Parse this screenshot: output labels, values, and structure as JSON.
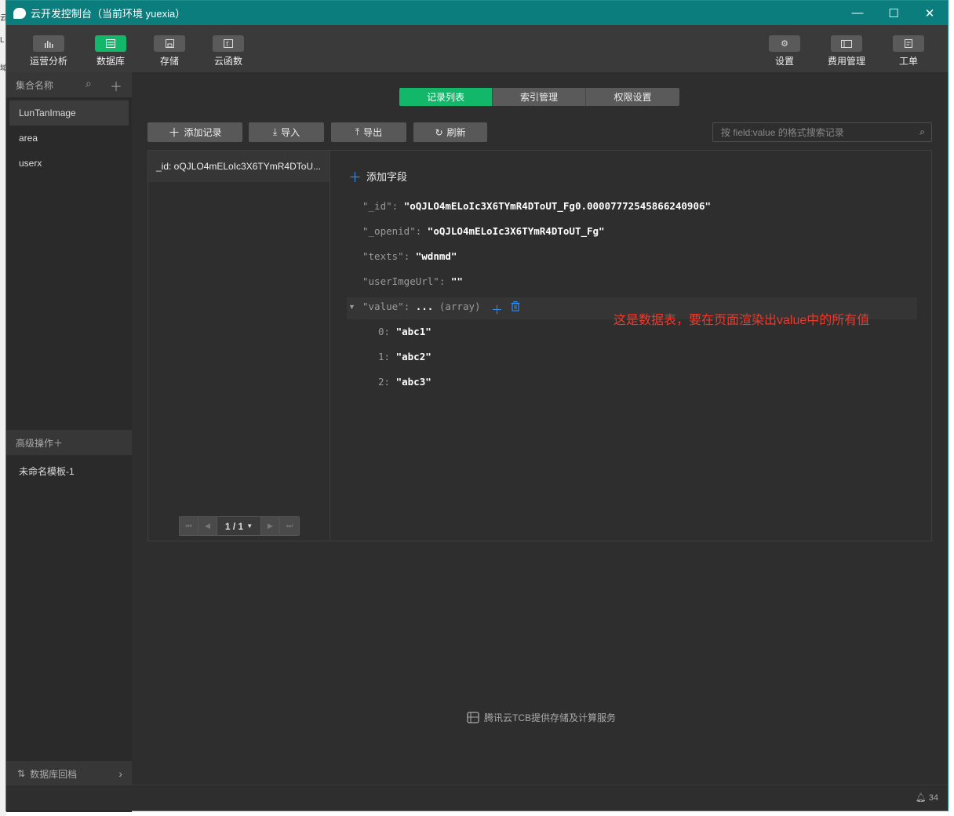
{
  "window": {
    "title": "云开发控制台（当前环境 yuexia）",
    "minimize": "—",
    "maximize": "☐",
    "close": "✕"
  },
  "toolbar": {
    "left": [
      {
        "label": "运营分析",
        "icon": "chart-icon"
      },
      {
        "label": "数据库",
        "icon": "database-icon"
      },
      {
        "label": "存储",
        "icon": "storage-icon"
      },
      {
        "label": "云函数",
        "icon": "function-icon"
      }
    ],
    "right": [
      {
        "label": "设置",
        "icon": "gear-icon"
      },
      {
        "label": "费用管理",
        "icon": "billing-icon"
      },
      {
        "label": "工单",
        "icon": "ticket-icon"
      }
    ]
  },
  "sidebar": {
    "collections_header": "集合名称",
    "collections": [
      "LunTanImage",
      "area",
      "userx"
    ],
    "advanced_header": "高级操作",
    "advanced_items": [
      "未命名模板-1"
    ],
    "backup": "数据库回档"
  },
  "tabs": [
    "记录列表",
    "索引管理",
    "权限设置"
  ],
  "actions": {
    "add": "添加记录",
    "import": "导入",
    "export": "导出",
    "refresh": "刷新",
    "search_placeholder": "按 field:value 的格式搜索记录"
  },
  "records": [
    "_id: oQJLO4mELoIc3X6TYmR4DToU..."
  ],
  "pager": {
    "label": "1 / 1"
  },
  "detail": {
    "add_field": "添加字段",
    "fields": [
      {
        "key": "\"_id\"",
        "value": "\"oQJLO4mELoIc3X6TYmR4DToUT_Fg0.00007772545866240906\""
      },
      {
        "key": "\"_openid\"",
        "value": "\"oQJLO4mELoIc3X6TYmR4DToUT_Fg\""
      },
      {
        "key": "\"texts\"",
        "value": "\"wdnmd\""
      },
      {
        "key": "\"userImgeUrl\"",
        "value": "\"\""
      }
    ],
    "array_field": {
      "key": "\"value\"",
      "value": "...",
      "type": "(array)"
    },
    "array_items": [
      {
        "index": "0:",
        "value": "\"abc1\""
      },
      {
        "index": "1:",
        "value": "\"abc2\""
      },
      {
        "index": "2:",
        "value": "\"abc3\""
      }
    ]
  },
  "annotation": "这是数据表，要在页面渲染出value中的所有值",
  "footer": "腾讯云TCB提供存储及计算服务",
  "status": {
    "notifications": "34"
  },
  "left_edge_text": [
    "云",
    "L",
    "域"
  ]
}
